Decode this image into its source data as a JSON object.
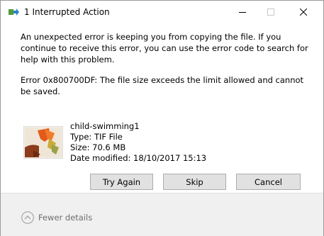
{
  "window": {
    "title": "1 Interrupted Action"
  },
  "message": {
    "line1": "An unexpected error is keeping you from copying the file. If you continue to receive this error, you can use the error code to search for help with this problem.",
    "line2": "Error 0x800700DF: The file size exceeds the limit allowed and cannot be saved."
  },
  "file": {
    "name": "child-swimming1",
    "type": "Type: TIF File",
    "size": "Size: 70.6 MB",
    "modified": "Date modified: 18/10/2017 15:13"
  },
  "buttons": {
    "try_again": "Try Again",
    "skip": "Skip",
    "cancel": "Cancel"
  },
  "footer": {
    "fewer_details": "Fewer details"
  },
  "icons": {
    "title": "copy-progress-icon",
    "minimize": "minimize-icon",
    "maximize": "maximize-icon",
    "close": "close-icon",
    "thumbnail": "image-thumbnail",
    "fewer": "chevron-up-circle-icon"
  }
}
